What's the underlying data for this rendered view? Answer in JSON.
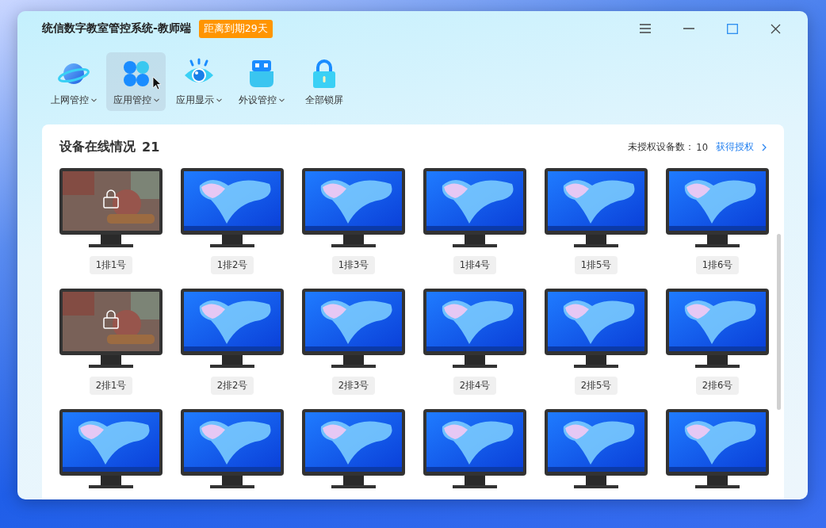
{
  "window": {
    "title": "统信数字教室管控系统-教师端",
    "license_badge": "距离到期29天"
  },
  "toolbar": [
    {
      "kind": "planet",
      "label": "上网管控",
      "has_menu": true,
      "selected": false
    },
    {
      "kind": "apps",
      "label": "应用管控",
      "has_menu": true,
      "selected": true
    },
    {
      "kind": "eye",
      "label": "应用显示",
      "has_menu": true,
      "selected": false
    },
    {
      "kind": "usb",
      "label": "外设管控",
      "has_menu": true,
      "selected": false
    },
    {
      "kind": "lock",
      "label": "全部锁屏",
      "has_menu": false,
      "selected": false
    }
  ],
  "panel": {
    "title": "设备在线情况",
    "online_count": "21",
    "unauthorized_label": "未授权设备数：",
    "unauthorized_count": "10",
    "authorize_link": "获得授权",
    "rows": [
      {
        "devices": [
          {
            "label": "1排1号",
            "locked": true
          },
          {
            "label": "1排2号",
            "locked": false
          },
          {
            "label": "1排3号",
            "locked": false
          },
          {
            "label": "1排4号",
            "locked": false
          },
          {
            "label": "1排5号",
            "locked": false
          },
          {
            "label": "1排6号",
            "locked": false
          }
        ]
      },
      {
        "devices": [
          {
            "label": "2排1号",
            "locked": true
          },
          {
            "label": "2排2号",
            "locked": false
          },
          {
            "label": "2排3号",
            "locked": false
          },
          {
            "label": "2排4号",
            "locked": false
          },
          {
            "label": "2排5号",
            "locked": false
          },
          {
            "label": "2排6号",
            "locked": false
          }
        ]
      },
      {
        "devices": [
          {
            "locked": false
          },
          {
            "locked": false
          },
          {
            "locked": false
          },
          {
            "locked": false
          },
          {
            "locked": false
          },
          {
            "locked": false
          }
        ]
      }
    ]
  }
}
